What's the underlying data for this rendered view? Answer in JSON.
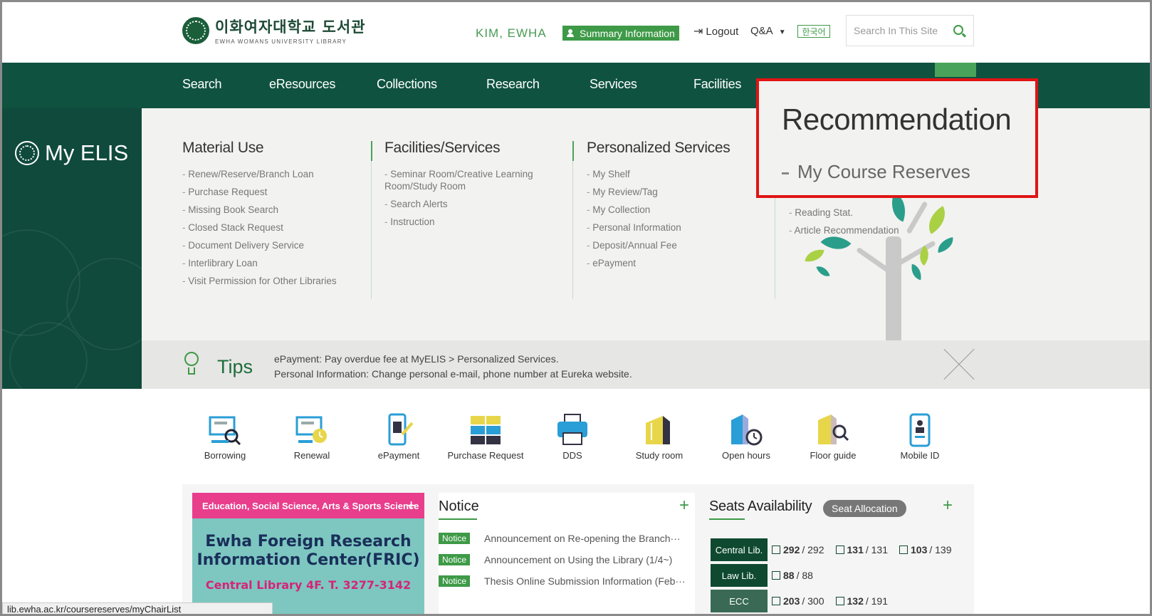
{
  "header": {
    "logo_korean": "이화여자대학교 도서관",
    "logo_english": "EWHA WOMANS UNIVERSITY LIBRARY",
    "user_name": "KIM, EWHA",
    "summary_label": "Summary Information",
    "logout_label": "Logout",
    "qa_label": "Q&A",
    "lang_label": "한국어",
    "search_placeholder": "Search In This Site"
  },
  "nav": {
    "items": [
      "Search",
      "eResources",
      "Collections",
      "Research",
      "Services",
      "Facilities"
    ]
  },
  "sidebar": {
    "title": "My ELIS"
  },
  "menu": {
    "columns": [
      {
        "title": "Material Use",
        "items": [
          "Renew/Reserve/Branch Loan",
          "Purchase Request",
          "Missing Book Search",
          "Closed Stack Request",
          "Document Delivery Service",
          "Interlibrary Loan",
          "Visit Permission for Other Libraries"
        ]
      },
      {
        "title": "Facilities/Services",
        "items": [
          "Seminar Room/Creative Learning Room/Study Room",
          "Search Alerts",
          "Instruction"
        ]
      },
      {
        "title": "Personalized Services",
        "items": [
          "My Shelf",
          "My Review/Tag",
          "My Collection",
          "Personal Information",
          "Deposit/Annual Fee",
          "ePayment"
        ]
      },
      {
        "title": "",
        "items": [
          "Reading Stat.",
          "Article Recommendation"
        ]
      }
    ]
  },
  "highlight": {
    "title": "Recommendation",
    "item": "My Course Reserves"
  },
  "tips": {
    "label": "Tips",
    "line1": "ePayment: Pay overdue fee at MyELIS > Personalized Services.",
    "line2": "Personal Information: Change personal e-mail, phone number at Eureka website."
  },
  "quick": {
    "items": [
      {
        "label": "Borrowing",
        "icon": "borrowing-icon"
      },
      {
        "label": "Renewal",
        "icon": "renewal-icon"
      },
      {
        "label": "ePayment",
        "icon": "epayment-icon"
      },
      {
        "label": "Purchase Request",
        "icon": "purchase-request-icon"
      },
      {
        "label": "DDS",
        "icon": "dds-icon"
      },
      {
        "label": "Study room",
        "icon": "study-room-icon"
      },
      {
        "label": "Open hours",
        "icon": "open-hours-icon"
      },
      {
        "label": "Floor guide",
        "icon": "floor-guide-icon"
      },
      {
        "label": "Mobile ID",
        "icon": "mobile-id-icon"
      }
    ]
  },
  "banner": {
    "category": "Education, Social Science, Arts & Sports Science",
    "title_line1": "Ewha Foreign Research",
    "title_line2": "Information Center(FRIC)",
    "subtitle": "Central Library 4F. T. 3277-3142"
  },
  "notice": {
    "title": "Notice",
    "items": [
      {
        "badge": "Notice",
        "text": "Announcement on Re-opening the Branch···"
      },
      {
        "badge": "Notice",
        "text": "Announcement on Using the Library (1/4~)"
      },
      {
        "badge": "Notice",
        "text": "Thesis Online Submission Information (Feb···"
      }
    ]
  },
  "seats": {
    "title": "Seats Availability",
    "alloc_label": "Seat Allocation",
    "rows": [
      {
        "library": "Central Lib.",
        "values": [
          [
            "292",
            "/ 292"
          ],
          [
            "131",
            "/ 131"
          ],
          [
            "103",
            "/ 139"
          ]
        ]
      },
      {
        "library": "Law Lib.",
        "values": [
          [
            "88",
            "/ 88"
          ]
        ]
      },
      {
        "library": "ECC",
        "values": [
          [
            "203",
            "/ 300"
          ],
          [
            "132",
            "/ 191"
          ]
        ]
      }
    ]
  },
  "status_url": "lib.ewha.ac.kr/coursereserves/myChairList",
  "colors": {
    "nav_green": "#0f5240",
    "accent_green": "#3e9a47",
    "highlight_red": "#e01414",
    "banner_pink": "#e83e8c"
  }
}
